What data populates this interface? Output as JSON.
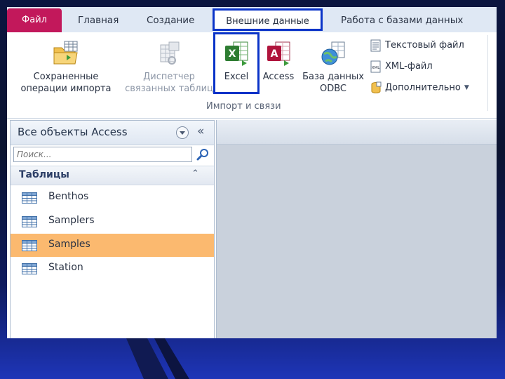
{
  "ribbon_tabs": {
    "file": "Файл",
    "home": "Главная",
    "create": "Создание",
    "external": "Внешние данные",
    "database_tools": "Работа с базами данных"
  },
  "import_group": {
    "saved_imports": {
      "line1": "Сохраненные",
      "line2": "операции импорта"
    },
    "linked_table_manager": {
      "line1": "Диспетчер",
      "line2": "связанных таблиц"
    },
    "excel": "Excel",
    "access": "Access",
    "odbc": {
      "line1": "База данных",
      "line2": "ODBC"
    },
    "text_file": "Текстовый файл",
    "xml_file": "XML-файл",
    "more": "Дополнительно",
    "group_label": "Импорт и связи"
  },
  "nav_pane": {
    "title": "Все объекты Access",
    "collapse_glyph": "«",
    "search_placeholder": "Поиск...",
    "group_title": "Таблицы",
    "group_toggle_glyph": "⌃",
    "tables": [
      {
        "label": "Benthos",
        "selected": false
      },
      {
        "label": "Samplers",
        "selected": false
      },
      {
        "label": "Samples",
        "selected": true
      },
      {
        "label": "Station",
        "selected": false
      }
    ]
  },
  "icons": {
    "saved_imports": "folder-with-table-icon",
    "linked_table_manager": "linked-table-manager-icon",
    "excel": "excel-icon",
    "access": "access-icon",
    "odbc": "odbc-globe-icon",
    "text_file": "text-file-icon",
    "xml_file": "xml-file-icon",
    "more": "database-more-icon",
    "search": "search-icon",
    "table": "table-icon"
  },
  "colors": {
    "file_tab": "#c2185b",
    "highlight_frame": "#0a33c8",
    "selected_row": "#fbb96f",
    "workspace": "#c9d1dc"
  }
}
